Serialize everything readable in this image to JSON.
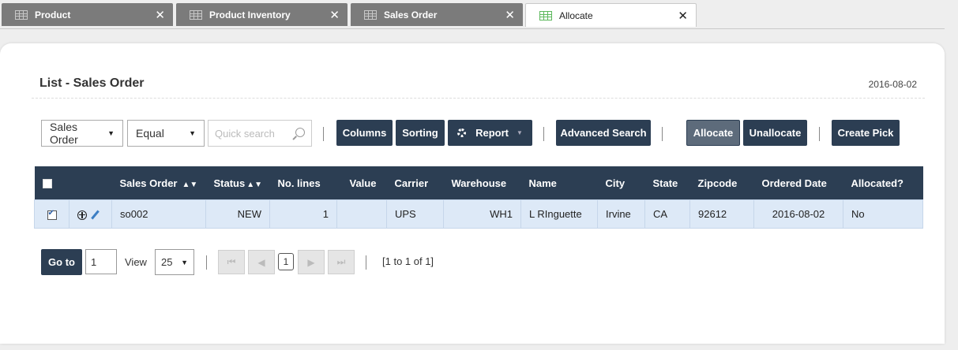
{
  "tabs": [
    {
      "label": "Product",
      "active": false
    },
    {
      "label": "Product Inventory",
      "active": false
    },
    {
      "label": "Sales Order",
      "active": false
    },
    {
      "label": "Allocate",
      "active": true
    }
  ],
  "header": {
    "title": "List - Sales Order",
    "date": "2016-08-02"
  },
  "toolbar": {
    "field_select": "Sales Order",
    "operator_select": "Equal",
    "quick_search_placeholder": "Quick search",
    "columns_label": "Columns",
    "sorting_label": "Sorting",
    "report_label": "Report",
    "advanced_search_label": "Advanced Search",
    "allocate_label": "Allocate",
    "unallocate_label": "Unallocate",
    "create_pick_label": "Create Pick"
  },
  "table": {
    "columns": [
      "",
      "",
      "Sales Order",
      "Status",
      "No. lines",
      "Value",
      "Carrier",
      "Warehouse",
      "Name",
      "City",
      "State",
      "Zipcode",
      "Ordered Date",
      "Allocated?"
    ],
    "rows": [
      {
        "selected": true,
        "sales_order": "so002",
        "status": "NEW",
        "no_lines": "1",
        "value": "",
        "carrier": "UPS",
        "warehouse": "WH1",
        "name": "L RInguette",
        "city": "Irvine",
        "state": "CA",
        "zipcode": "92612",
        "ordered_date": "2016-08-02",
        "allocated": "No"
      }
    ]
  },
  "pager": {
    "goto_label": "Go to",
    "goto_value": "1",
    "view_label": "View",
    "page_size": "25",
    "current_page": "1",
    "range_text": "[1 to 1 of 1]"
  },
  "colors": {
    "header_bg": "#2c3e53",
    "row_selected_bg": "#dde9f7",
    "tab_inactive_bg": "#7b7b7b",
    "tab_icon_active": "#5cb85c"
  }
}
